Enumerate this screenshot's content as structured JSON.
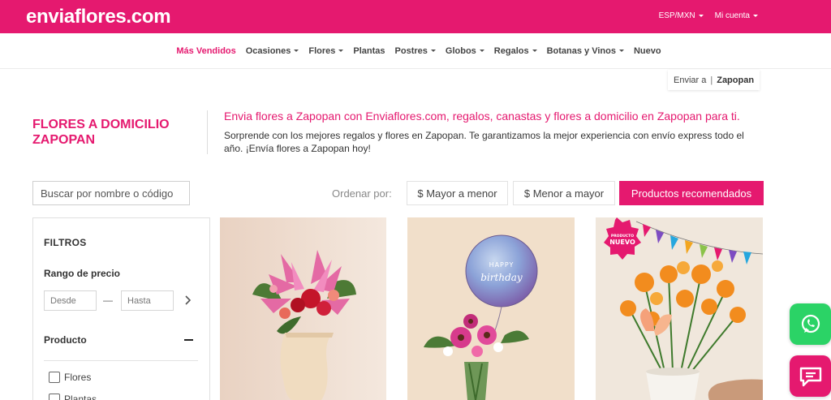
{
  "header": {
    "logo": "enviaflores.com",
    "currency": "ESP/MXN",
    "account": "Mi cuenta"
  },
  "nav": [
    {
      "label": "Más Vendidos",
      "dropdown": false,
      "active": true
    },
    {
      "label": "Ocasiones",
      "dropdown": true
    },
    {
      "label": "Flores",
      "dropdown": true
    },
    {
      "label": "Plantas",
      "dropdown": false
    },
    {
      "label": "Postres",
      "dropdown": true
    },
    {
      "label": "Globos",
      "dropdown": true
    },
    {
      "label": "Regalos",
      "dropdown": true
    },
    {
      "label": "Botanas y Vinos",
      "dropdown": true
    },
    {
      "label": "Nuevo",
      "dropdown": false
    }
  ],
  "ship_to": {
    "label": "Enviar a",
    "separator": "|",
    "city": "Zapopan"
  },
  "page": {
    "title": "FLORES A DOMICILIO ZAPOPAN",
    "headline": "Envia flores a Zapopan con Enviaflores.com, regalos, canastas y flores a domicilio en Zapopan para ti.",
    "description": "Sorprende con los mejores regalos y flores en Zapopan. Te garantizamos la mejor experiencia con envío express todo el año. ¡Envía flores a Zapopan hoy!"
  },
  "search": {
    "placeholder": "Buscar por nombre o código"
  },
  "sort": {
    "label": "Ordenar por:",
    "options": [
      "$ Mayor a menor",
      "$ Menor a mayor",
      "Productos recomendados"
    ],
    "selected": "Productos recomendados"
  },
  "filters": {
    "title": "FILTROS",
    "price_title": "Rango de precio",
    "from_placeholder": "Desde",
    "to_placeholder": "Hasta",
    "dash": "—",
    "product_title": "Producto",
    "options": [
      "Flores",
      "Plantas"
    ]
  },
  "products": [
    {
      "image": "pink-lilies-roses-vase-icon",
      "badge": ""
    },
    {
      "image": "balloon-gerbera-vase-icon",
      "balloon_text": "HAPPY birthday"
    },
    {
      "image": "marigold-pot-butterfly-icon",
      "badge": "PRODUCTO NUEVO"
    }
  ],
  "floating": {
    "whatsapp": "whatsapp-icon",
    "chat": "chat-icon"
  },
  "colors": {
    "brand": "#e5196f",
    "whatsapp": "#2bd366"
  }
}
